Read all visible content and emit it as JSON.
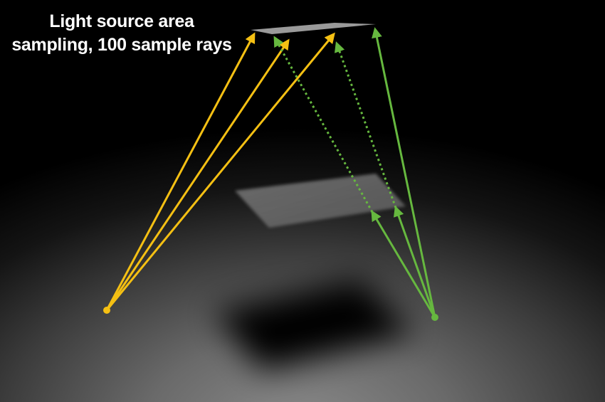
{
  "title_lines": [
    "Light source area",
    "sampling, 100 sample rays"
  ],
  "colors": {
    "background": "#000000",
    "floor_light": "#8a8a8a",
    "light_source": "#9a9a9a",
    "occluder": "#6e6e6e",
    "shadow": "#050505",
    "point_a_rays": "#f5c013",
    "point_b_rays": "#66b83f"
  }
}
